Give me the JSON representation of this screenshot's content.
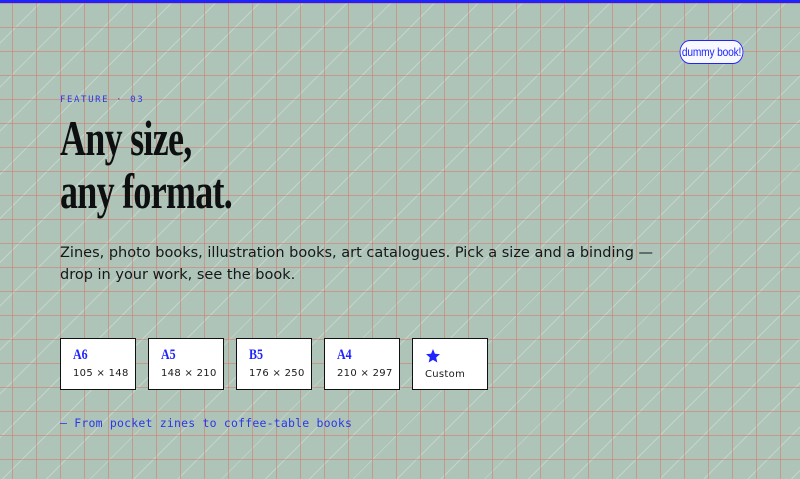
{
  "colors": {
    "background": "#aec4b8",
    "grid": "#d67864",
    "accent": "#1f24ff",
    "text": "#0e0f10"
  },
  "badge": {
    "label": "dummy book!"
  },
  "eyebrow": {
    "label": "FEATURE · 03"
  },
  "headline": {
    "line1": "Any size,",
    "line2": "any format."
  },
  "subtitle": {
    "text": "Zines, photo books, illustration books, art catalogues. Pick a size and a binding — drop in your work, see the book."
  },
  "sizes": [
    {
      "code": "A6",
      "dims": "105 × 148"
    },
    {
      "code": "A5",
      "dims": "148 × 210"
    },
    {
      "code": "B5",
      "dims": "176 × 250"
    },
    {
      "code": "A4",
      "dims": "210 × 297"
    },
    {
      "icon": "star-icon",
      "dims": "Custom"
    }
  ],
  "footnote": {
    "text": "— From pocket zines to coffee-table books"
  }
}
